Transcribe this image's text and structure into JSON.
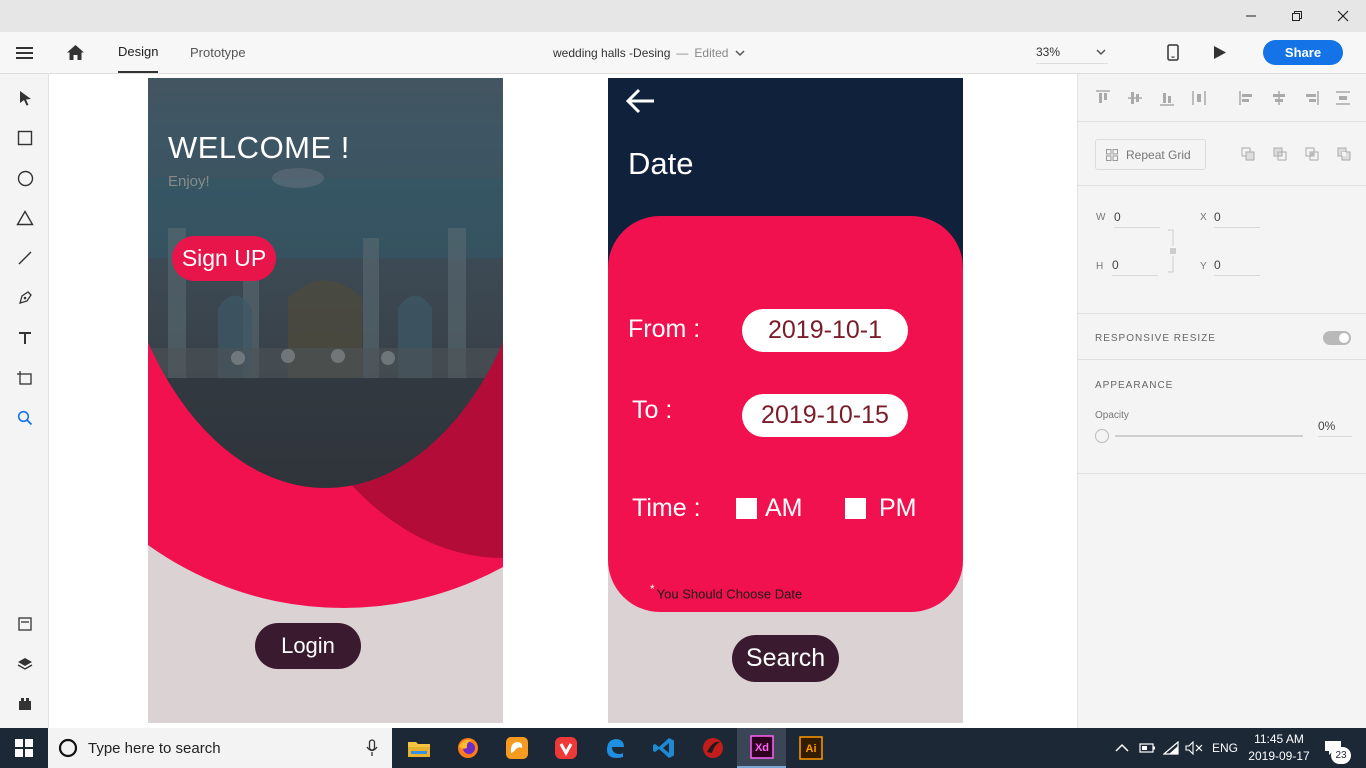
{
  "window": {
    "minimize": "—",
    "restore": "❐",
    "close": "✕"
  },
  "toolbar": {
    "tab_design": "Design",
    "tab_prototype": "Prototype",
    "doc_title": "wedding halls -Desing",
    "doc_sep": "—",
    "doc_status": "Edited",
    "zoom": "33%",
    "share": "Share"
  },
  "artboard1": {
    "welcome": "WELCOME !",
    "enjoy": "Enjoy!",
    "signup": "Sign UP",
    "login": "Login"
  },
  "artboard2": {
    "title": "Date",
    "from_label": "From :",
    "from_value": "2019-10-1",
    "to_label": "To :",
    "to_value": "2019-10-15",
    "time_label": "Time :",
    "am": "AM",
    "pm": "PM",
    "note_star": "*",
    "note": "You Should Choose Date",
    "search": "Search"
  },
  "panel": {
    "repeat_grid": "Repeat Grid",
    "w_label": "W",
    "w_value": "0",
    "h_label": "H",
    "h_value": "0",
    "x_label": "X",
    "x_value": "0",
    "y_label": "Y",
    "y_value": "0",
    "responsive_resize": "RESPONSIVE RESIZE",
    "appearance": "APPEARANCE",
    "opacity_label": "Opacity",
    "opacity_value": "0%"
  },
  "taskbar": {
    "search_placeholder": "Type here to search",
    "lang": "ENG",
    "time": "11:45 AM",
    "date": "2019-09-17",
    "notifications": "23"
  },
  "colors": {
    "accent_pink": "#f1114e",
    "navy": "#0f213b",
    "button_dark": "#3a1a2e",
    "share_blue": "#1473e6"
  }
}
